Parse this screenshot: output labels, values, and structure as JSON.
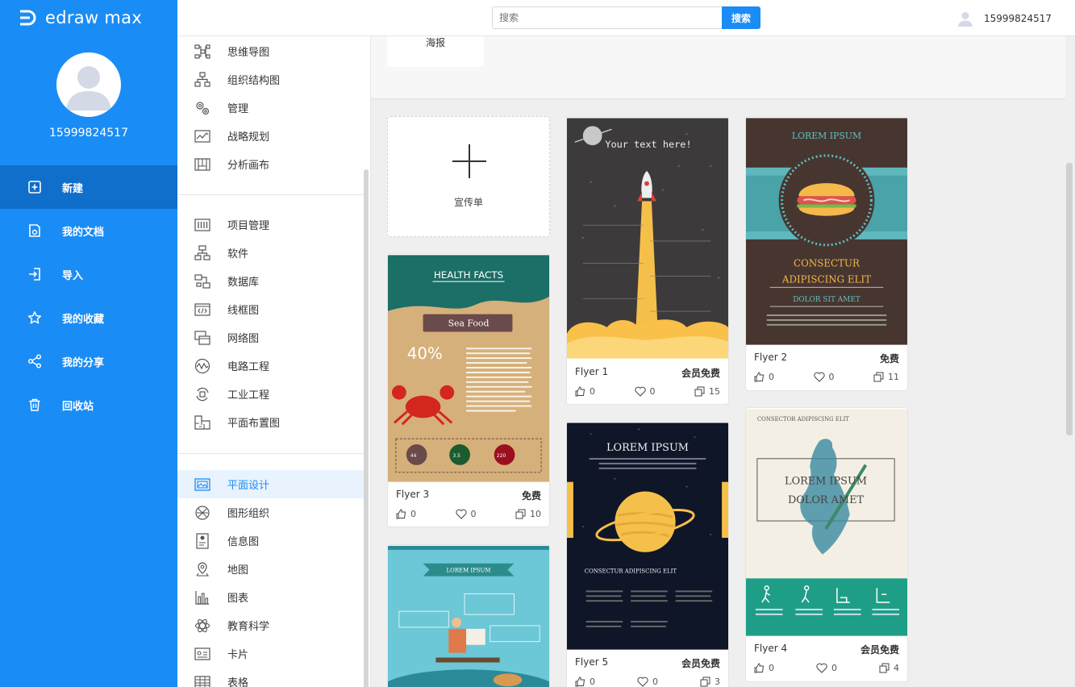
{
  "app": {
    "logo_text": "edraw max",
    "user_id": "15999824517"
  },
  "nav": {
    "items": [
      {
        "label": "新建",
        "icon": "plus-square-icon",
        "active": true
      },
      {
        "label": "我的文档",
        "icon": "document-icon",
        "active": false
      },
      {
        "label": "导入",
        "icon": "import-icon",
        "active": false
      },
      {
        "label": "我的收藏",
        "icon": "star-icon",
        "active": false
      },
      {
        "label": "我的分享",
        "icon": "share-icon",
        "active": false
      },
      {
        "label": "回收站",
        "icon": "trash-icon",
        "active": false
      }
    ]
  },
  "header": {
    "search_placeholder": "搜索",
    "search_button": "搜索",
    "user_id": "15999824517"
  },
  "categories": {
    "group1": [
      "思维导图",
      "组织结构图",
      "管理",
      "战略规划",
      "分析画布"
    ],
    "group2": [
      "项目管理",
      "软件",
      "数据库",
      "线框图",
      "网络图",
      "电路工程",
      "工业工程",
      "平面布置图"
    ],
    "group3": [
      "平面设计",
      "图形组织",
      "信息图",
      "地图",
      "图表",
      "教育科学",
      "卡片",
      "表格"
    ],
    "active": "平面设计"
  },
  "main": {
    "strip_card_label": "海报",
    "add_card_label": "宣传单",
    "templates": [
      {
        "id": "flyer1",
        "name": "Flyer 1",
        "price": "会员免费",
        "likes": "0",
        "favorites": "0",
        "copies": "15",
        "thumb_text": "Your text here!"
      },
      {
        "id": "flyer2",
        "name": "Flyer 2",
        "price": "免费",
        "likes": "0",
        "favorites": "0",
        "copies": "11",
        "thumb_title": "LOREM IPSUM",
        "thumb_line1": "CONSECTUR",
        "thumb_line2": "ADIPISCING ELIT",
        "thumb_line3": "DOLOR SIT AMET"
      },
      {
        "id": "flyer3",
        "name": "Flyer 3",
        "price": "免费",
        "likes": "0",
        "favorites": "0",
        "copies": "10",
        "thumb_title": "HEALTH FACTS",
        "thumb_banner": "Sea Food",
        "thumb_percent": "40%",
        "thumb_stats": [
          "44",
          "3.5",
          "220"
        ]
      },
      {
        "id": "flyer4",
        "name": "Flyer 4",
        "price": "会员免费",
        "likes": "0",
        "favorites": "0",
        "copies": "4",
        "thumb_small": "CONSECTOR ADIPISCING ELIT",
        "thumb_line1": "LOREM IPSUM",
        "thumb_line2": "DOLOR AMET"
      },
      {
        "id": "flyer5",
        "name": "Flyer 5",
        "price": "会员免费",
        "likes": "0",
        "favorites": "0",
        "copies": "3",
        "thumb_title": "LOREM IPSUM",
        "thumb_sub": "CONSECTUR ADIPISCING ELIT"
      },
      {
        "id": "flyer6",
        "thumb_title": "LOREM IPSUM"
      }
    ]
  },
  "colors": {
    "primary": "#1a8cf5",
    "primary_dark": "#0f6fcb"
  }
}
